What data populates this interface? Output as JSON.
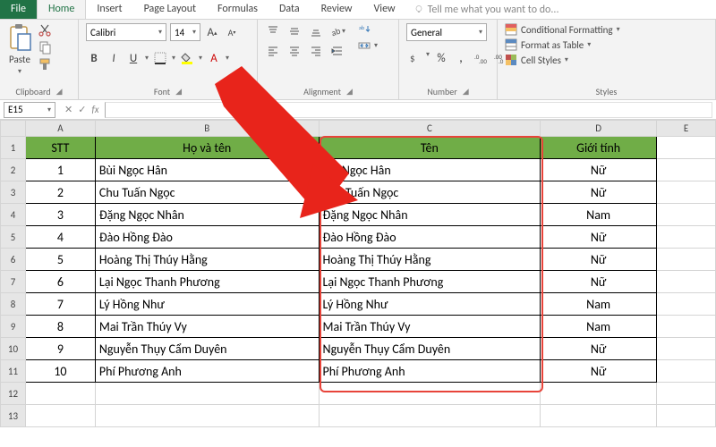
{
  "tabs": {
    "file": "File",
    "home": "Home",
    "insert": "Insert",
    "page_layout": "Page Layout",
    "formulas": "Formulas",
    "data": "Data",
    "review": "Review",
    "view": "View",
    "tell_me": "Tell me what you want to do..."
  },
  "ribbon": {
    "clipboard": {
      "paste": "Paste",
      "label": "Clipboard"
    },
    "font": {
      "name": "Calibri",
      "size": "14",
      "label": "Font"
    },
    "alignment": {
      "label": "Alignment"
    },
    "number": {
      "format": "General",
      "label": "Number"
    },
    "styles": {
      "cond": "Conditional Formatting",
      "table": "Format as Table",
      "cell": "Cell Styles",
      "label": "Styles"
    }
  },
  "namebox": "E15",
  "columns": [
    "A",
    "B",
    "C",
    "D",
    "E"
  ],
  "headers": {
    "stt": "STT",
    "ho_va_ten": "Họ và tên",
    "ten": "Tên",
    "gioi_tinh": "Giới tính"
  },
  "rows": [
    {
      "stt": "1",
      "ho_va_ten": "Bùi Ngọc Hân",
      "ten": "Bùi Ngọc Hân",
      "gioi_tinh": "Nữ"
    },
    {
      "stt": "2",
      "ho_va_ten": "Chu Tuấn Ngọc",
      "ten": "Chu Tuấn Ngọc",
      "gioi_tinh": "Nữ"
    },
    {
      "stt": "3",
      "ho_va_ten": "Đặng Ngọc Nhân",
      "ten": "Đặng Ngọc Nhân",
      "gioi_tinh": "Nam"
    },
    {
      "stt": "4",
      "ho_va_ten": "Đào Hồng Đào",
      "ten": "Đào Hồng Đào",
      "gioi_tinh": "Nữ"
    },
    {
      "stt": "5",
      "ho_va_ten": "Hoàng Thị Thúy Hằng",
      "ten": "Hoàng Thị Thúy Hằng",
      "gioi_tinh": "Nữ"
    },
    {
      "stt": "6",
      "ho_va_ten": "Lại Ngọc Thanh Phương",
      "ten": "Lại Ngọc Thanh Phương",
      "gioi_tinh": "Nữ"
    },
    {
      "stt": "7",
      "ho_va_ten": "Lý Hồng Như",
      "ten": "Lý Hồng Như",
      "gioi_tinh": "Nam"
    },
    {
      "stt": "8",
      "ho_va_ten": "Mai Trần Thúy Vy",
      "ten": "Mai Trần Thúy Vy",
      "gioi_tinh": "Nam"
    },
    {
      "stt": "9",
      "ho_va_ten": "Nguyễn Thụy Cẩm Duyên",
      "ten": "Nguyễn Thụy Cẩm Duyên",
      "gioi_tinh": "Nữ"
    },
    {
      "stt": "10",
      "ho_va_ten": "Phí Phương Anh",
      "ten": "Phí Phương Anh",
      "gioi_tinh": "Nữ"
    }
  ]
}
